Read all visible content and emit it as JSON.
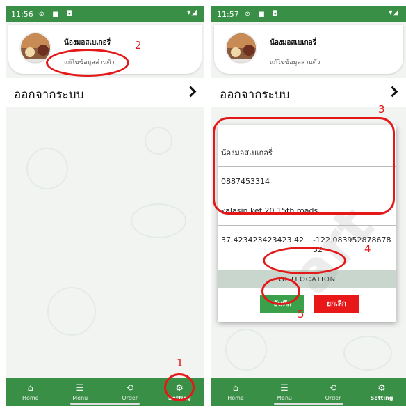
{
  "left_screen": {
    "status_time": "11:56",
    "shop_name": "น้องมอสเบเกอรี่",
    "edit_profile": "แก้ไขข้อมูลส่วนตัว",
    "logout_label": "ออกจากระบบ"
  },
  "right_screen": {
    "status_time": "11:57",
    "shop_name": "น้องมอสเบเกอรี่",
    "edit_profile": "แก้ไขข้อมูลส่วนตัว",
    "logout_label": "ออกจากระบบ",
    "dialog": {
      "name_value": "น้องมอสเบเกอรี่",
      "phone_value": "0887453314",
      "address_value": "kalasin ket 20 15th roads",
      "latitude": "37.423423423423 42",
      "longitude": "-122.083952878678 32",
      "getlocation_label": "GETLOCATION",
      "save_label": "บันทึก",
      "cancel_label": "ยกเลิก"
    }
  },
  "bottom_nav": [
    {
      "label": "Home",
      "icon": "home-icon"
    },
    {
      "label": "Menu",
      "icon": "menu-icon"
    },
    {
      "label": "Order",
      "icon": "history-icon"
    },
    {
      "label": "Setting",
      "icon": "gear-icon"
    }
  ],
  "annotations": [
    "1",
    "2",
    "3",
    "4",
    "5"
  ],
  "colors": {
    "primary_green": "#3a8f47",
    "annotation_red": "#e41818",
    "save_green": "#3aa14a",
    "cancel_red": "#e81818"
  }
}
